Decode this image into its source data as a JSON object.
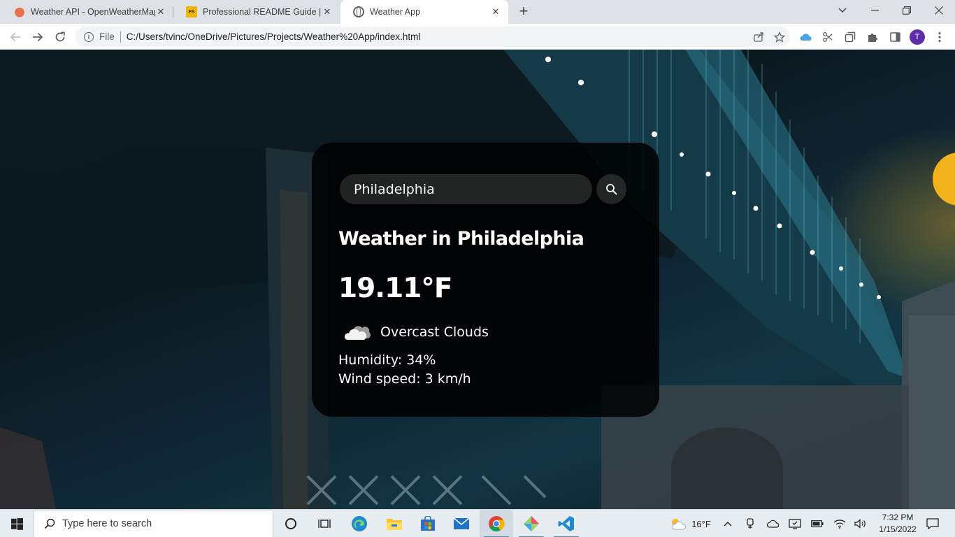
{
  "browser": {
    "tabs": [
      {
        "title": "Weather API - OpenWeatherMap",
        "favicon": "openweathermap-icon"
      },
      {
        "title": "Professional README Guide | The",
        "favicon": "fs-icon"
      },
      {
        "title": "Weather App",
        "favicon": "globe-icon",
        "active": true
      }
    ],
    "address": {
      "scheme_label": "File",
      "url": "C:/Users/tvinc/OneDrive/Pictures/Projects/Weather%20App/index.html"
    },
    "profile_initial": "T"
  },
  "weather": {
    "search_value": "Philadelphia",
    "city_heading": "Weather in Philadelphia",
    "temperature": "19.11°F",
    "description": "Overcast Clouds",
    "icon": "overcast-clouds-icon",
    "humidity": "Humidity: 34%",
    "wind": "Wind speed: 3 km/h"
  },
  "taskbar": {
    "search_placeholder": "Type here to search",
    "weather_temp": "16°F",
    "time": "7:32 PM",
    "date": "1/15/2022"
  },
  "colors": {
    "card_bg": "rgba(0,0,0,0.86)",
    "search_bg": "rgba(124,124,124,0.27)",
    "tab_strip": "#dee1e6",
    "profile": "#5b2ea8",
    "taskbar": "#e7ecf0"
  }
}
